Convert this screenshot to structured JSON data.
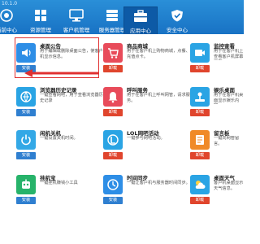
{
  "app": {
    "version": "10.1.0"
  },
  "nav": [
    {
      "label": "当前中心",
      "icon": "eye-icon"
    },
    {
      "label": "资源管理",
      "icon": "grid-icon"
    },
    {
      "label": "客户机管理",
      "icon": "monitor-icon"
    },
    {
      "label": "服务器管理",
      "icon": "server-icon"
    },
    {
      "label": "应用中心",
      "icon": "toolbox-icon",
      "active": true
    },
    {
      "label": "安全中心",
      "icon": "shield-icon"
    }
  ],
  "apps": [
    {
      "title": "桌面公告",
      "desc": "用于编辑或删除桌面公告，使客户机显示信息。",
      "button": "安装",
      "state": "install",
      "color": "#2e8ee6",
      "icon": "speaker-icon"
    },
    {
      "title": "商品商城",
      "desc": "用于在客户机上购物商城，点餐、充值点卡。",
      "button": "卸载",
      "state": "uninstall",
      "color": "#e84b5a",
      "icon": "cart-icon"
    },
    {
      "title": "监控查看",
      "desc": "用于在客户机上查看客户机屏幕画面。",
      "button": "卸载",
      "state": "uninstall",
      "color": "#2aa4e4",
      "icon": "camera-icon"
    },
    {
      "title": "浏览器历史记录",
      "desc": "一键查看网吧，用于查看浏览器历史记录",
      "button": "安装",
      "state": "install",
      "color": "#2aa4e4",
      "icon": "browser-icon"
    },
    {
      "title": "呼叫服务",
      "desc": "用于在客户机上呼叫网管，请求服务。",
      "button": "卸载",
      "state": "uninstall",
      "color": "#e84b5a",
      "icon": "bell-icon"
    },
    {
      "title": "娱乐桌面",
      "desc": "用于在客户机桌面显示娱乐内容。",
      "button": "卸载",
      "state": "uninstall",
      "color": "#2aa4e4",
      "icon": "joystick-icon"
    },
    {
      "title": "闲机关机",
      "desc": "一键设置关机时间。",
      "button": "安装",
      "state": "install",
      "color": "#33a8e6",
      "icon": "power-icon"
    },
    {
      "title": "LOL网吧活动",
      "desc": "一键参与网吧活动。",
      "button": "卸载",
      "state": "uninstall",
      "color": "#2aa4e4",
      "icon": "lol-icon"
    },
    {
      "title": "留言板",
      "desc": "一键向网管留言。",
      "button": "卸载",
      "state": "uninstall",
      "color": "#f08a28",
      "icon": "note-icon"
    },
    {
      "title": "挂机宝",
      "desc": "一键挂机赚钱小工具",
      "button": "安装",
      "state": "install",
      "color": "#27b36a",
      "icon": "robot-icon"
    },
    {
      "title": "时间同步",
      "desc": "一键让客户机与服务器时间同步。",
      "button": "安装",
      "state": "install",
      "color": "#2e8ee6",
      "icon": "clock-icon"
    },
    {
      "title": "桌面天气",
      "desc": "客户机桌面显示天气信息。",
      "button": "卸载",
      "state": "uninstall",
      "color": "#2aa4e4",
      "icon": "weather-icon"
    }
  ]
}
